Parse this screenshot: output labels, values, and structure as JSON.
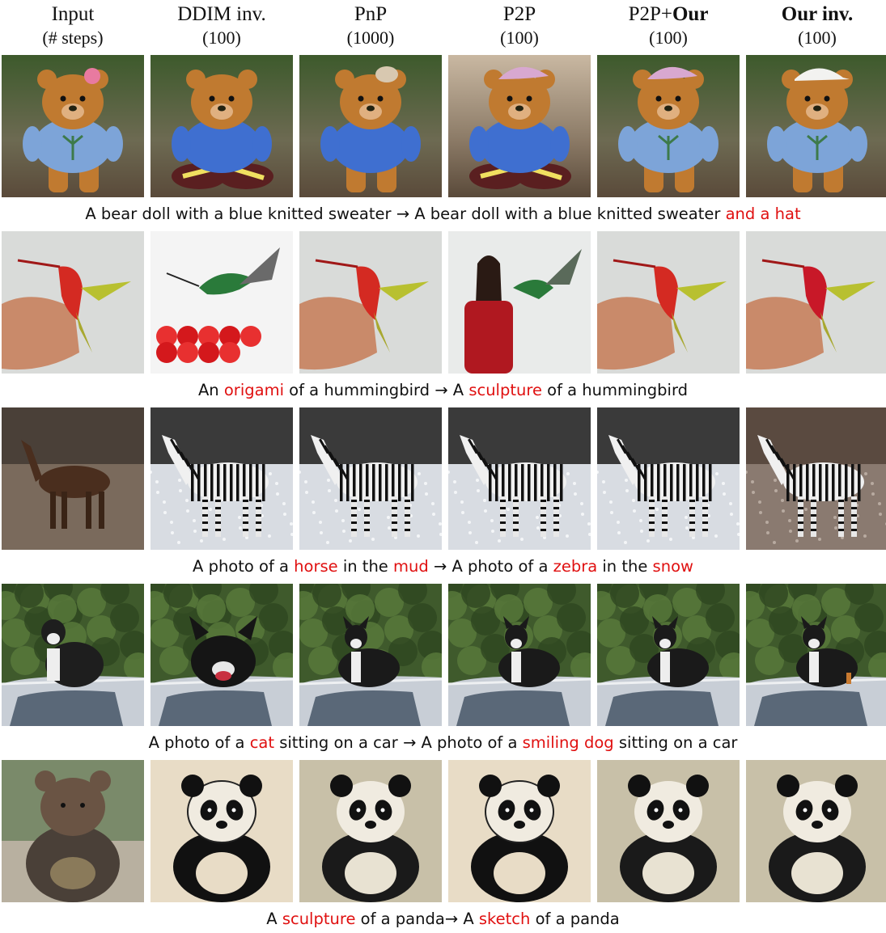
{
  "columns": [
    {
      "name": "Input",
      "steps": "(# steps)"
    },
    {
      "name": "DDIM inv.",
      "steps": "(100)"
    },
    {
      "name": "PnP",
      "steps": "(1000)"
    },
    {
      "name": "P2P",
      "steps": "(100)"
    },
    {
      "name": "P2P+",
      "name_bold": "Our",
      "steps": "(100)"
    },
    {
      "name": "",
      "name_bold": "Our inv.",
      "steps": "(100)"
    }
  ],
  "rows": [
    {
      "caption": [
        {
          "t": "A bear doll with a blue knitted sweater → A bear doll with a blue knitted sweater ",
          "hl": false
        },
        {
          "t": "and a hat",
          "hl": true
        }
      ],
      "scene": "teddy-bear"
    },
    {
      "caption": [
        {
          "t": "An ",
          "hl": false
        },
        {
          "t": "origami",
          "hl": true
        },
        {
          "t": " of a hummingbird → A ",
          "hl": false
        },
        {
          "t": "sculpture",
          "hl": true
        },
        {
          "t": " of a hummingbird",
          "hl": false
        }
      ],
      "scene": "hummingbird"
    },
    {
      "caption": [
        {
          "t": "A photo of a ",
          "hl": false
        },
        {
          "t": "horse",
          "hl": true
        },
        {
          "t": " in the ",
          "hl": false
        },
        {
          "t": "mud",
          "hl": true
        },
        {
          "t": " → A photo of a ",
          "hl": false
        },
        {
          "t": "zebra",
          "hl": true
        },
        {
          "t": " in the ",
          "hl": false
        },
        {
          "t": "snow",
          "hl": true
        }
      ],
      "scene": "horse-zebra"
    },
    {
      "caption": [
        {
          "t": "A photo of a ",
          "hl": false
        },
        {
          "t": "cat",
          "hl": true
        },
        {
          "t": " sitting on a car → A photo of a ",
          "hl": false
        },
        {
          "t": "smiling dog",
          "hl": true
        },
        {
          "t": " sitting on a car",
          "hl": false
        }
      ],
      "scene": "cat-dog-car"
    },
    {
      "caption": [
        {
          "t": "A ",
          "hl": false
        },
        {
          "t": "sculpture",
          "hl": true
        },
        {
          "t": " of a panda→ A ",
          "hl": false
        },
        {
          "t": "sketch",
          "hl": true
        },
        {
          "t": " of a panda",
          "hl": false
        }
      ],
      "scene": "panda"
    }
  ],
  "colors": {
    "highlight": "#e01010",
    "text": "#111111"
  }
}
